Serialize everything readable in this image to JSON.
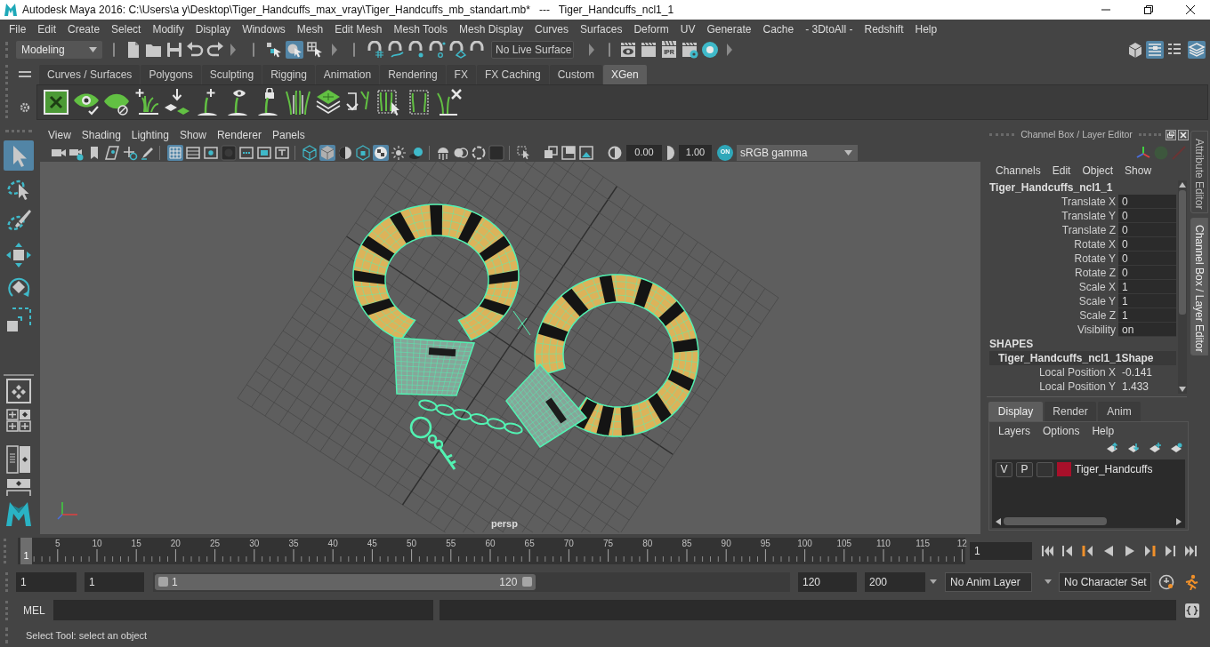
{
  "window": {
    "title": "Autodesk Maya 2016: C:\\Users\\a y\\Desktop\\Tiger_Handcuffs_max_vray\\Tiger_Handcuffs_mb_standart.mb*   ---   Tiger_Handcuffs_ncl1_1"
  },
  "menu_bar": [
    "File",
    "Edit",
    "Create",
    "Select",
    "Modify",
    "Display",
    "Windows",
    "Mesh",
    "Edit Mesh",
    "Mesh Tools",
    "Mesh Display",
    "Curves",
    "Surfaces",
    "Deform",
    "UV",
    "Generate",
    "Cache",
    "- 3DtoAll -",
    "Redshift",
    "Help"
  ],
  "status_line": {
    "menu_set": "Modeling",
    "selection_modes": [
      {
        "selected": false
      },
      {
        "selected": true
      },
      {
        "selected": false
      }
    ],
    "live_surface": "No Live Surface",
    "ipr_label": "IPR",
    "panel_toggles": [
      {
        "selected": false
      },
      {
        "selected": true
      },
      {
        "selected": false
      },
      {
        "selected": true
      }
    ]
  },
  "shelf": {
    "tabs": [
      {
        "label": "Curves / Surfaces",
        "selected": false
      },
      {
        "label": "Polygons",
        "selected": false
      },
      {
        "label": "Sculpting",
        "selected": false
      },
      {
        "label": "Rigging",
        "selected": false
      },
      {
        "label": "Animation",
        "selected": false
      },
      {
        "label": "Rendering",
        "selected": false
      },
      {
        "label": "FX",
        "selected": false
      },
      {
        "label": "FX Caching",
        "selected": false
      },
      {
        "label": "Custom",
        "selected": false
      },
      {
        "label": "XGen",
        "selected": true
      }
    ]
  },
  "toolbox": {
    "tools": [
      {
        "selected": true
      },
      {
        "selected": false
      },
      {
        "selected": false
      },
      {
        "selected": false
      },
      {
        "selected": false
      },
      {
        "selected": false
      }
    ]
  },
  "viewport": {
    "menus": [
      "View",
      "Shading",
      "Lighting",
      "Show",
      "Renderer",
      "Panels"
    ],
    "toggles": [
      {
        "selected": false
      },
      {
        "selected": false
      },
      {
        "selected": false
      },
      {
        "selected": false
      },
      {
        "selected": false
      },
      {
        "selected": false
      },
      {
        "selected": true
      },
      {
        "selected": false
      },
      {
        "selected": false
      },
      {
        "selected": false
      },
      {
        "selected": false
      },
      {
        "selected": false
      },
      {
        "selected": false
      },
      {
        "selected": false
      },
      {
        "selected": true
      },
      {
        "selected": false
      },
      {
        "selected": false
      },
      {
        "selected": true
      },
      {
        "selected": false
      },
      {
        "selected": false
      },
      {
        "selected": false
      },
      {
        "selected": false
      },
      {
        "selected": false
      },
      {
        "selected": false
      },
      {
        "selected": false
      },
      {
        "selected": false
      },
      {
        "selected": false
      },
      {
        "selected": false
      }
    ],
    "exposure": "0.00",
    "gamma": "1.00",
    "color_management": "ON",
    "view_transform": "sRGB gamma",
    "camera": "persp"
  },
  "channel_box": {
    "title": "Channel Box / Layer Editor",
    "menus": [
      "Channels",
      "Edit",
      "Object",
      "Show"
    ],
    "object": "Tiger_Handcuffs_ncl1_1",
    "channels": [
      {
        "name": "Translate X",
        "value": "0"
      },
      {
        "name": "Translate Y",
        "value": "0"
      },
      {
        "name": "Translate Z",
        "value": "0"
      },
      {
        "name": "Rotate X",
        "value": "0"
      },
      {
        "name": "Rotate Y",
        "value": "0"
      },
      {
        "name": "Rotate Z",
        "value": "0"
      },
      {
        "name": "Scale X",
        "value": "1"
      },
      {
        "name": "Scale Y",
        "value": "1"
      },
      {
        "name": "Scale Z",
        "value": "1"
      },
      {
        "name": "Visibility",
        "value": "on"
      }
    ],
    "shapes_heading": "SHAPES",
    "shape": "Tiger_Handcuffs_ncl1_1Shape",
    "shape_channels": [
      {
        "name": "Local Position X",
        "value": "-0.141"
      },
      {
        "name": "Local Position Y",
        "value": "1.433"
      }
    ]
  },
  "layer_editor": {
    "tabs": [
      {
        "label": "Display",
        "selected": true
      },
      {
        "label": "Render",
        "selected": false
      },
      {
        "label": "Anim",
        "selected": false
      }
    ],
    "menus": [
      "Layers",
      "Options",
      "Help"
    ],
    "layers": [
      {
        "visibility": "V",
        "playback": "P",
        "color": "#a8102a",
        "name": "Tiger_Handcuffs"
      }
    ]
  },
  "side_tabs": [
    {
      "label": "Attribute Editor",
      "selected": false
    },
    {
      "label": "Channel Box / Layer Editor",
      "selected": true
    }
  ],
  "time_slider": {
    "ticks": [
      "5",
      "10",
      "15",
      "20",
      "25",
      "30",
      "35",
      "40",
      "45",
      "50",
      "55",
      "60",
      "65",
      "70",
      "75",
      "80",
      "85",
      "90",
      "95",
      "100",
      "105",
      "110",
      "115",
      "12"
    ],
    "current_frame": "1",
    "frame_field": "1"
  },
  "range_slider": {
    "start_time": "1",
    "playback_start": "1",
    "range_start": "1",
    "range_end": "120",
    "level": 0.6,
    "playback_end": "120",
    "end_time": "200",
    "anim_layer": "No Anim Layer",
    "character_set": "No Character Set"
  },
  "command_line": {
    "language": "MEL"
  },
  "help_line": "Select Tool: select an object"
}
